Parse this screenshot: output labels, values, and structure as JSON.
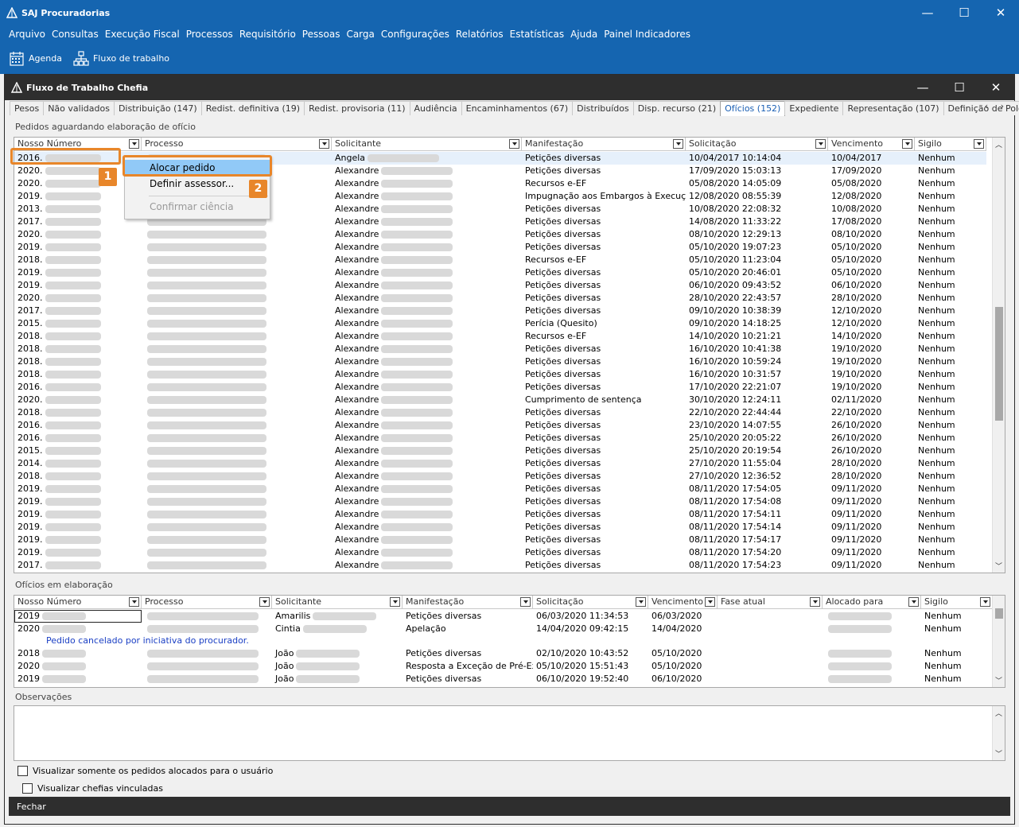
{
  "app": {
    "title": "SAJ Procuradorias"
  },
  "window_controls": {
    "minimize": "—",
    "maximize": "☐",
    "close": "✕"
  },
  "menu": [
    "Arquivo",
    "Consultas",
    "Execução Fiscal",
    "Processos",
    "Requisitório",
    "Pessoas",
    "Carga",
    "Configurações",
    "Relatórios",
    "Estatísticas",
    "Ajuda",
    "Painel Indicadores"
  ],
  "toolbar": {
    "agenda": "Agenda",
    "workflow": "Fluxo de trabalho"
  },
  "child": {
    "title": "Fluxo de Trabalho Chefia"
  },
  "tabs": [
    "Pesos",
    "Não validados",
    "Distribuição (147)",
    "Redist. definitiva (19)",
    "Redist. provisoria (11)",
    "Audiência",
    "Encaminhamentos (67)",
    "Distribuídos",
    "Disp. recurso (21)",
    "Ofícios (152)",
    "Expediente",
    "Representação (107)",
    "Definição de Polo de Atu"
  ],
  "active_tab": "Ofícios (152)",
  "tab_nav": "‹ ›",
  "top_grid": {
    "label": "Pedidos aguardando elaboração de ofício",
    "columns": [
      "Nosso Número",
      "Processo",
      "Solicitante",
      "Manifestação",
      "Solicitação",
      "Vencimento",
      "Sigilo"
    ],
    "rows": [
      [
        "2016.",
        "",
        "Angela",
        "Petições diversas",
        "10/04/2017 10:14:04",
        "10/04/2017",
        "Nenhum"
      ],
      [
        "2020.",
        "",
        "Alexandre",
        "Petições diversas",
        "17/09/2020 15:03:13",
        "17/09/2020",
        "Nenhum"
      ],
      [
        "2020.",
        "",
        "Alexandre",
        "Recursos e-EF",
        "05/08/2020 14:05:09",
        "05/08/2020",
        "Nenhum"
      ],
      [
        "2019.",
        "",
        "Alexandre",
        "Impugnação aos Embargos à Execução F",
        "12/08/2020 08:55:39",
        "12/08/2020",
        "Nenhum"
      ],
      [
        "2013.",
        "",
        "Alexandre",
        "Petições diversas",
        "10/08/2020 22:08:32",
        "10/08/2020",
        "Nenhum"
      ],
      [
        "2017.",
        "",
        "Alexandre",
        "Petições diversas",
        "14/08/2020 11:33:22",
        "17/08/2020",
        "Nenhum"
      ],
      [
        "2020.",
        "",
        "Alexandre",
        "Petições diversas",
        "08/10/2020 12:29:13",
        "08/10/2020",
        "Nenhum"
      ],
      [
        "2019.",
        "",
        "Alexandre",
        "Petições diversas",
        "05/10/2020 19:07:23",
        "05/10/2020",
        "Nenhum"
      ],
      [
        "2018.",
        "",
        "Alexandre",
        "Recursos e-EF",
        "05/10/2020 11:23:04",
        "05/10/2020",
        "Nenhum"
      ],
      [
        "2019.",
        "",
        "Alexandre",
        "Petições diversas",
        "05/10/2020 20:46:01",
        "05/10/2020",
        "Nenhum"
      ],
      [
        "2019.",
        "",
        "Alexandre",
        "Petições diversas",
        "06/10/2020 09:43:52",
        "06/10/2020",
        "Nenhum"
      ],
      [
        "2020.",
        "",
        "Alexandre",
        "Petições diversas",
        "28/10/2020 22:43:57",
        "28/10/2020",
        "Nenhum"
      ],
      [
        "2017.",
        "",
        "Alexandre",
        "Petições diversas",
        "09/10/2020 10:38:39",
        "12/10/2020",
        "Nenhum"
      ],
      [
        "2015.",
        "",
        "Alexandre",
        "Perícia (Quesito)",
        "09/10/2020 14:18:25",
        "12/10/2020",
        "Nenhum"
      ],
      [
        "2018.",
        "",
        "Alexandre",
        "Recursos e-EF",
        "14/10/2020 10:21:21",
        "14/10/2020",
        "Nenhum"
      ],
      [
        "2018.",
        "",
        "Alexandre",
        "Petições diversas",
        "16/10/2020 10:41:38",
        "19/10/2020",
        "Nenhum"
      ],
      [
        "2018.",
        "",
        "Alexandre",
        "Petições diversas",
        "16/10/2020 10:59:24",
        "19/10/2020",
        "Nenhum"
      ],
      [
        "2018.",
        "",
        "Alexandre",
        "Petições diversas",
        "16/10/2020 10:31:57",
        "19/10/2020",
        "Nenhum"
      ],
      [
        "2016.",
        "",
        "Alexandre",
        "Petições diversas",
        "17/10/2020 22:21:07",
        "19/10/2020",
        "Nenhum"
      ],
      [
        "2020.",
        "",
        "Alexandre",
        "Cumprimento de sentença",
        "30/10/2020 12:24:11",
        "02/11/2020",
        "Nenhum"
      ],
      [
        "2018.",
        "",
        "Alexandre",
        "Petições diversas",
        "22/10/2020 22:44:44",
        "22/10/2020",
        "Nenhum"
      ],
      [
        "2016.",
        "",
        "Alexandre",
        "Petições diversas",
        "23/10/2020 14:07:55",
        "26/10/2020",
        "Nenhum"
      ],
      [
        "2016.",
        "",
        "Alexandre",
        "Petições diversas",
        "25/10/2020 20:05:22",
        "26/10/2020",
        "Nenhum"
      ],
      [
        "2015.",
        "",
        "Alexandre",
        "Petições diversas",
        "25/10/2020 20:19:54",
        "26/10/2020",
        "Nenhum"
      ],
      [
        "2014.",
        "",
        "Alexandre",
        "Petições diversas",
        "27/10/2020 11:55:04",
        "28/10/2020",
        "Nenhum"
      ],
      [
        "2018.",
        "",
        "Alexandre",
        "Petições diversas",
        "27/10/2020 12:36:52",
        "28/10/2020",
        "Nenhum"
      ],
      [
        "2019.",
        "",
        "Alexandre",
        "Petições diversas",
        "08/11/2020 17:54:05",
        "09/11/2020",
        "Nenhum"
      ],
      [
        "2019.",
        "",
        "Alexandre",
        "Petições diversas",
        "08/11/2020 17:54:08",
        "09/11/2020",
        "Nenhum"
      ],
      [
        "2019.",
        "",
        "Alexandre",
        "Petições diversas",
        "08/11/2020 17:54:11",
        "09/11/2020",
        "Nenhum"
      ],
      [
        "2019.",
        "",
        "Alexandre",
        "Petições diversas",
        "08/11/2020 17:54:14",
        "09/11/2020",
        "Nenhum"
      ],
      [
        "2019.",
        "",
        "Alexandre",
        "Petições diversas",
        "08/11/2020 17:54:17",
        "09/11/2020",
        "Nenhum"
      ],
      [
        "2019.",
        "",
        "Alexandre",
        "Petições diversas",
        "08/11/2020 17:54:20",
        "09/11/2020",
        "Nenhum"
      ],
      [
        "2017.",
        "",
        "Alexandre",
        "Petições diversas",
        "08/11/2020 17:54:23",
        "09/11/2020",
        "Nenhum"
      ]
    ]
  },
  "context_menu": {
    "items": [
      "Alocar pedido",
      "Definir assessor...",
      "Confirmar ciência"
    ],
    "active": "Alocar pedido",
    "disabled": "Confirmar ciência"
  },
  "badges": [
    "1",
    "2"
  ],
  "bottom_grid": {
    "label": "Ofícios em elaboração",
    "columns": [
      "Nosso Número",
      "Processo",
      "Solicitante",
      "Manifestação",
      "Solicitação",
      "Vencimento",
      "Fase atual",
      "Alocado para",
      "Sigilo"
    ],
    "rows": [
      [
        "2019",
        "",
        "Amarilis",
        "Petições diversas",
        "06/03/2020 11:34:53",
        "06/03/2020",
        "",
        "",
        "Nenhum"
      ],
      [
        "2020",
        "",
        "Cintia",
        "Apelação",
        "14/04/2020 09:42:15",
        "14/04/2020",
        "",
        "",
        "Nenhum"
      ],
      [
        "2018",
        "",
        "João",
        "Petições diversas",
        "02/10/2020 10:43:52",
        "05/10/2020",
        "",
        "",
        "Nenhum"
      ],
      [
        "2020",
        "",
        "João",
        "Resposta a Exceção de Pré-Exec",
        "05/10/2020 15:51:43",
        "05/10/2020",
        "",
        "",
        "Nenhum"
      ],
      [
        "2019",
        "",
        "João",
        "Petições diversas",
        "06/10/2020 19:52:40",
        "06/10/2020",
        "",
        "",
        "Nenhum"
      ]
    ],
    "note": "Pedido cancelado por iniciativa do procurador."
  },
  "observacoes": {
    "label": "Observações"
  },
  "checkboxes": {
    "only_allocated": "Visualizar somente os pedidos alocados para o usuário",
    "linked_heads": "Visualizar chefias vinculadas"
  },
  "footer": {
    "close": "Fechar"
  },
  "colors": {
    "title_blue": "#1565b0",
    "dark_bar": "#2e2e2e",
    "highlight_orange": "#e8862a",
    "menu_selection": "#91c9f7",
    "note_blue": "#1a3fc4"
  }
}
